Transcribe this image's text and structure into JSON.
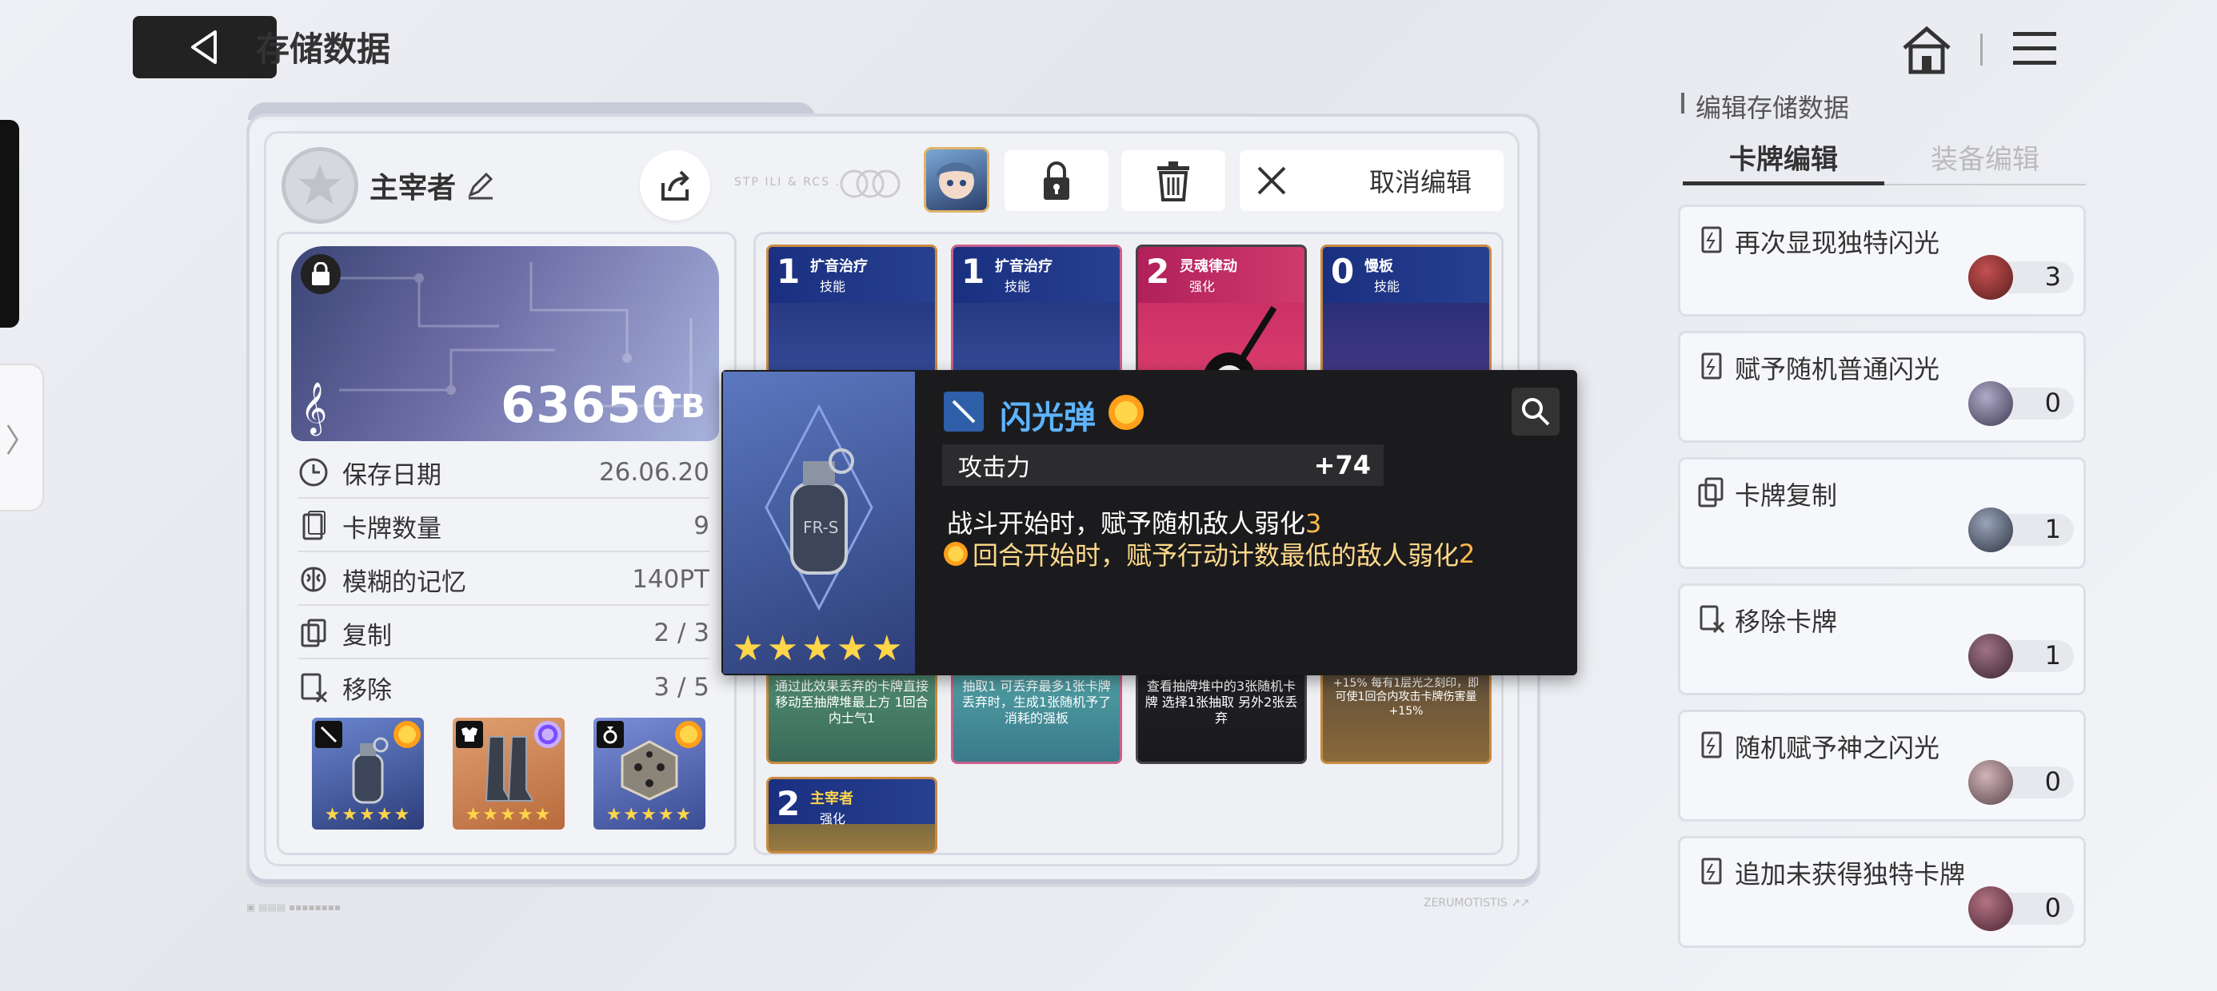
{
  "header": {
    "title": "存储数据"
  },
  "player": {
    "name": "主宰者"
  },
  "decor": {
    "deco_text": "STP ILI & RCS .",
    "footer_right": "ZERUMOTISTIS ↗↗"
  },
  "toolbar": {
    "cancel_label": "取消编辑"
  },
  "storage": {
    "value": "63650",
    "unit": "TB"
  },
  "stats": [
    {
      "label": "保存日期",
      "value": "26.06.20"
    },
    {
      "label": "卡牌数量",
      "value": "9"
    },
    {
      "label": "模糊的记忆",
      "value": "140PT"
    },
    {
      "label": "复制",
      "value": "2 / 3"
    },
    {
      "label": "移除",
      "value": "3 / 5"
    }
  ],
  "equipment": [
    {
      "icon": "sword-icon",
      "stars": "★★★★★",
      "rarity_color": "#ffb020"
    },
    {
      "icon": "armor-icon",
      "stars": "★★★★★",
      "rarity_color": "#9a6cff"
    },
    {
      "icon": "ring-icon",
      "stars": "★★★★★",
      "rarity_color": "#ffb020"
    }
  ],
  "deck": [
    {
      "cost": "1",
      "name": "扩音治疗",
      "type": "技能",
      "desc": "通过此效果丢弃的卡牌直接移动至抽牌堆最上方 1回合内士气1"
    },
    {
      "cost": "1",
      "name": "扩音治疗",
      "type": "技能",
      "desc": "抽取1 可丢弃最多1张卡牌 丢弃时，生成1张随机予了消耗的强板"
    },
    {
      "cost": "2",
      "name": "灵魂律动",
      "type": "强化",
      "desc": "查看抽牌堆中的3张随机卡牌 选择1张抽取 另外2张丢弃"
    },
    {
      "cost": "0",
      "name": "慢板",
      "type": "技能",
      "desc": "使1回合内攻击卡牌伤害量+15% 每有1层光之刻印，即可使1回合内攻击卡牌伤害量+15%"
    },
    {
      "cost": "2",
      "name": "主宰者",
      "type": "强化",
      "desc": ""
    }
  ],
  "tooltip": {
    "name": "闪光弹",
    "stat_label": "攻击力",
    "stat_value": "+74",
    "line1_text": "战斗开始时，赋予随机敌人弱化",
    "line1_num": "3",
    "line2_text": "回合开始时，赋予行动计数最低的敌人弱化",
    "line2_num": "2",
    "stars": "★★★★★"
  },
  "right_panel": {
    "title": "编辑存储数据",
    "tabs": [
      "卡牌编辑",
      "装备编辑"
    ],
    "options": [
      {
        "label": "再次显现独特闪光",
        "count": "3",
        "mat_color": "#8a2e2e"
      },
      {
        "label": "赋予随机普通闪光",
        "count": "0",
        "mat_color": "#6b6680"
      },
      {
        "label": "卡牌复制",
        "count": "1",
        "mat_color": "#5c6476"
      },
      {
        "label": "移除卡牌",
        "count": "1",
        "mat_color": "#6a4a54"
      },
      {
        "label": "随机赋予神之闪光",
        "count": "0",
        "mat_color": "#8c7478"
      },
      {
        "label": "追加未获得独特卡牌",
        "count": "0",
        "mat_color": "#7a4a58"
      }
    ]
  },
  "colors": {
    "accent_blue": "#5db4ff",
    "accent_orange": "#ffb84a",
    "dark": "#222222"
  }
}
